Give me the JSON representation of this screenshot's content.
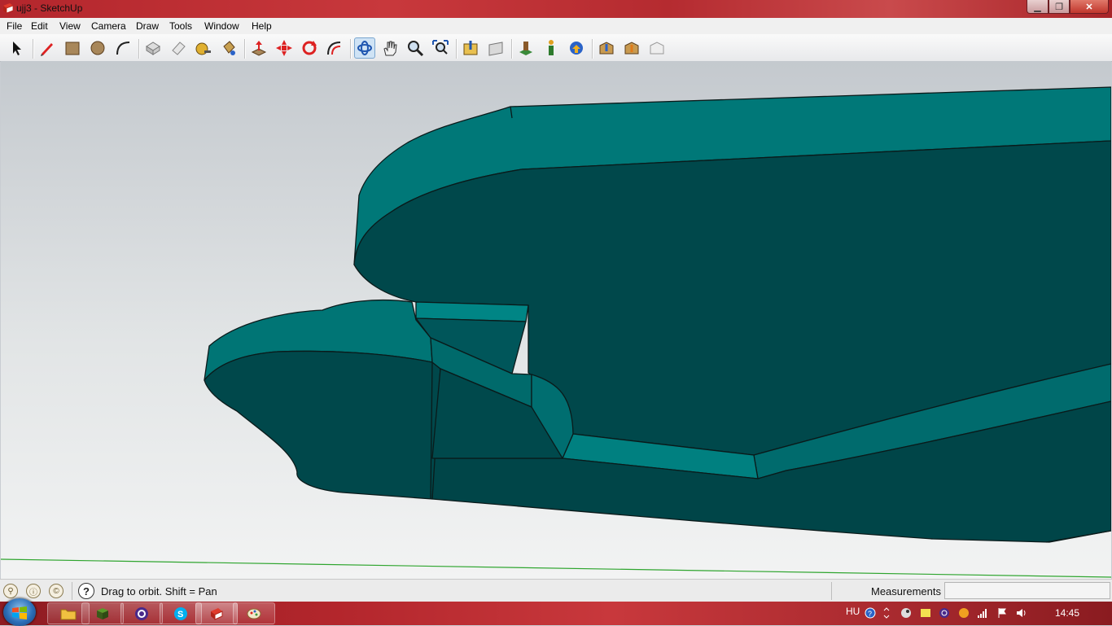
{
  "window": {
    "title": "ujj3 - SketchUp",
    "min_glyph": "▁",
    "max_glyph": "❐",
    "close_glyph": "✕"
  },
  "menu": [
    "File",
    "Edit",
    "View",
    "Camera",
    "Draw",
    "Tools",
    "Window",
    "Help"
  ],
  "toolbar": {
    "tools": [
      "select-tool",
      "pencil-line-tool",
      "rectangle-tool",
      "circle-tool",
      "arc-tool",
      "make-component-tool",
      "eraser-tool",
      "tape-measure-tool",
      "paint-bucket-tool",
      "push-pull-tool",
      "move-tool",
      "rotate-tool",
      "offset-tool",
      "orbit-tool",
      "pan-tool",
      "zoom-tool",
      "zoom-extents-tool",
      "get-models-tool",
      "share-model-tool",
      "share-component-tool",
      "place-model-tool",
      "preview-google-earth-tool",
      "get-photo-texture-tool",
      "3d-warehouse-tool",
      "extension-tool"
    ],
    "active_tool": "orbit-tool"
  },
  "status": {
    "hint": "Drag to orbit.  Shift = Pan",
    "measurements_label": "Measurements",
    "measurements_value": "",
    "left_icons": [
      "geo-location-icon",
      "credits-icon",
      "copyright-icon"
    ]
  },
  "taskbar": {
    "apps": [
      "windows-explorer",
      "minecraft",
      "eclipse-like-app",
      "skype",
      "sketchup",
      "paint"
    ],
    "active_app": "sketchup",
    "language": "HU",
    "time": "14:45"
  },
  "colors": {
    "model_light": "#007575",
    "model_dark": "#00484b",
    "model_mid": "#006565",
    "axis_green": "#2fa52f",
    "titlebar": "#b8292f"
  }
}
